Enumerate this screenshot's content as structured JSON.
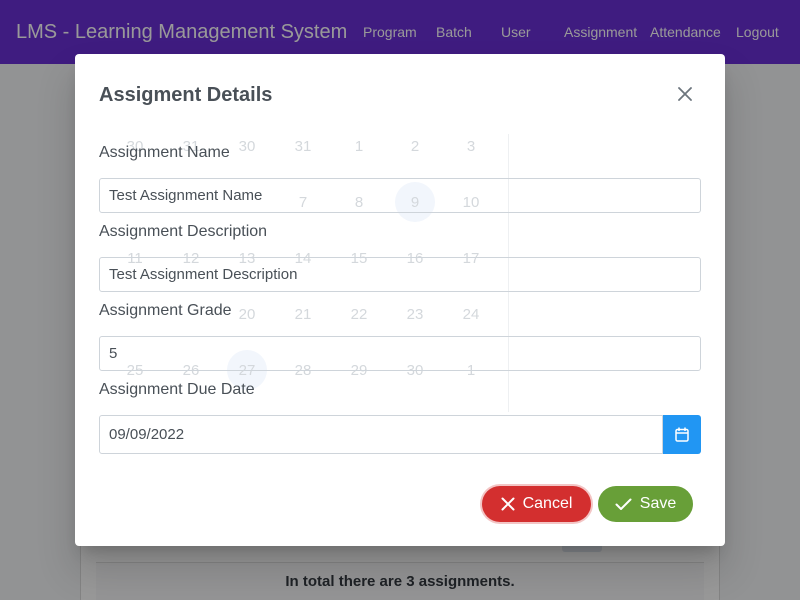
{
  "navbar": {
    "title": "LMS - Learning Management System",
    "items": [
      "Program",
      "Batch",
      "User",
      "Assignment",
      "Attendance",
      "Logout"
    ]
  },
  "page": {
    "summary": "In total there are 3 assignments."
  },
  "dialog": {
    "title": "Assigment Details",
    "fields": {
      "name": {
        "label": "Assignment Name",
        "value": "Test Assignment Name"
      },
      "description": {
        "label": "Assignment Description",
        "value": "Test Assignment Description"
      },
      "grade": {
        "label": "Assignment Grade",
        "value": "5"
      },
      "due_date": {
        "label": "Assignment Due Date",
        "value": "09/09/2022"
      }
    },
    "buttons": {
      "cancel": "Cancel",
      "save": "Save"
    },
    "calendar_days": [
      "30",
      "31",
      "1",
      "2",
      "3",
      "7",
      "8",
      "9",
      "10",
      "11",
      "12",
      "13",
      "14",
      "15",
      "16",
      "17",
      "20",
      "21",
      "22",
      "23",
      "24",
      "25",
      "26",
      "27",
      "28",
      "29",
      "30",
      "1"
    ]
  },
  "colors": {
    "navbar": "#6a2fd6",
    "primary": "#2196f3",
    "cancel": "#d32f2f",
    "save": "#689f38"
  }
}
